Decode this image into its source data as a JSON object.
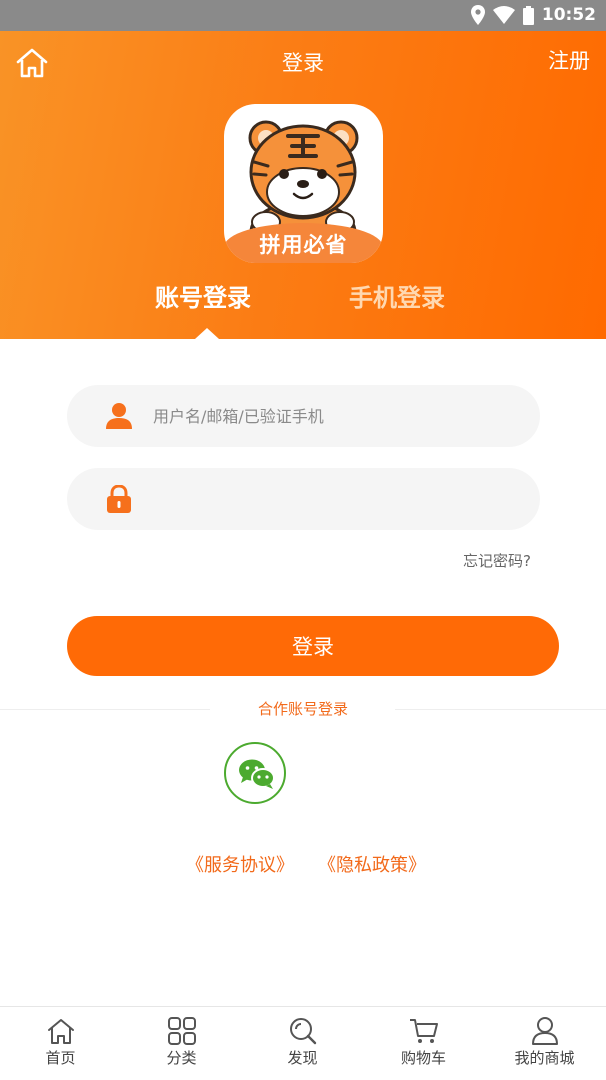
{
  "status_bar": {
    "time": "10:52"
  },
  "header": {
    "title": "登录",
    "register_label": "注册",
    "logo_text": "拼用必省",
    "tabs": [
      {
        "label": "账号登录",
        "active": true
      },
      {
        "label": "手机登录",
        "active": false
      }
    ]
  },
  "form": {
    "username_placeholder": "用户名/邮箱/已验证手机",
    "password_placeholder": "",
    "forgot_label": "忘记密码?",
    "login_label": "登录"
  },
  "third_party": {
    "title": "合作账号登录",
    "providers": [
      {
        "icon": "wechat-icon"
      }
    ]
  },
  "policies": {
    "service": "《服务协议》",
    "privacy": "《隐私政策》"
  },
  "colors": {
    "accent": "#ff6a06",
    "accent_light": "#f99326",
    "wechat": "#4caa2f"
  },
  "bottom_nav": [
    {
      "label": "首页",
      "icon": "home-icon"
    },
    {
      "label": "分类",
      "icon": "grid-icon"
    },
    {
      "label": "发现",
      "icon": "discover-icon"
    },
    {
      "label": "购物车",
      "icon": "cart-icon"
    },
    {
      "label": "我的商城",
      "icon": "user-icon"
    }
  ]
}
